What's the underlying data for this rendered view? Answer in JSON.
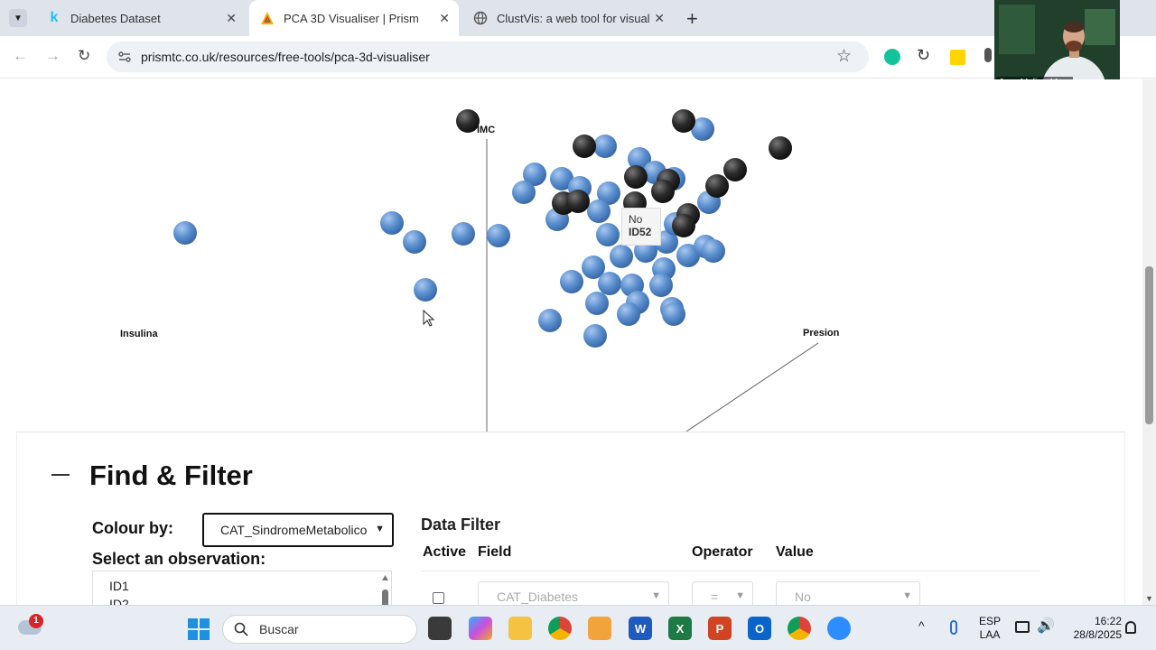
{
  "tabs": [
    {
      "title": "Diabetes Dataset",
      "favicon": "kaggle-k",
      "active": false
    },
    {
      "title": "PCA 3D Visualiser | Prism",
      "favicon": "prism-triangle",
      "active": true
    },
    {
      "title": "ClustVis: a web tool for visualizi",
      "favicon": "globe",
      "active": false
    }
  ],
  "address": {
    "url": "prismtc.co.uk/resources/free-tools/pca-3d-visualiser"
  },
  "webcam": {
    "name": "Jose Molina-Mora"
  },
  "plot": {
    "axis_labels": {
      "imc": "IMC",
      "insulina": "Insulina",
      "presion": "Presion"
    },
    "tooltip": {
      "category": "No",
      "id": "ID52"
    },
    "colors": {
      "no": "#5b8fcf",
      "si": "#2b2b2b"
    }
  },
  "find_filter": {
    "title": "Find & Filter",
    "colour_by_label": "Colour by:",
    "colour_by_value": "CAT_SindromeMetabolico",
    "select_observation_label": "Select an observation:",
    "observations": [
      "ID1",
      "ID2"
    ],
    "data_filter_title": "Data Filter",
    "columns": {
      "active": "Active",
      "field": "Field",
      "operator": "Operator",
      "value": "Value"
    },
    "filter_row": {
      "field": "CAT_Diabetes",
      "operator": "=",
      "value": "No"
    }
  },
  "taskbar": {
    "search_placeholder": "Buscar",
    "notification_count": "1",
    "language": "ESP",
    "layout": "LAA",
    "time": "16:22",
    "date": "28/8/2025"
  }
}
